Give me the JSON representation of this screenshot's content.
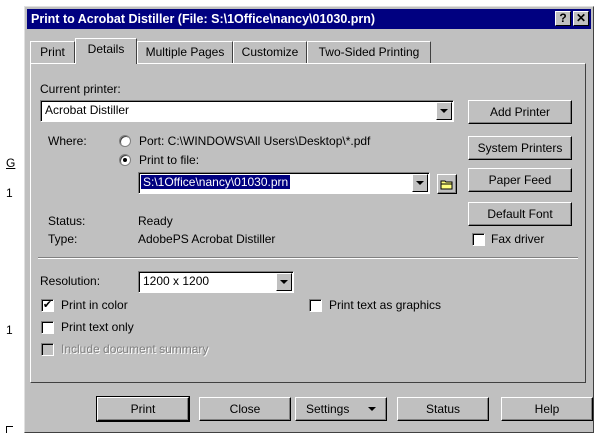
{
  "dialog": {
    "title": "Print to Acrobat Distiller   (File: S:\\1Office\\nancy\\01030.prn)",
    "help_glyph": "?",
    "close_glyph": "✕"
  },
  "tabs": [
    {
      "label": "Print"
    },
    {
      "label": "Details"
    },
    {
      "label": "Multiple Pages"
    },
    {
      "label": "Customize"
    },
    {
      "label": "Two-Sided Printing"
    }
  ],
  "details": {
    "current_printer_label": "Current printer:",
    "current_printer_value": "Acrobat Distiller",
    "where_label": "Where:",
    "port_label": "Port: C:\\WINDOWS\\All Users\\Desktop\\*.pdf",
    "print_to_file_label": "Print to file:",
    "file_path_value": "S:\\1Office\\nancy\\01030.prn",
    "status_label": "Status:",
    "status_value": "Ready",
    "type_label": "Type:",
    "type_value": "AdobePS Acrobat Distiller",
    "resolution_label": "Resolution:",
    "resolution_value": "1200 x 1200",
    "print_in_color": "Print in color",
    "print_text_only": "Print text only",
    "include_summary": "Include document summary",
    "print_text_graphics": "Print text as graphics",
    "fax_driver": "Fax driver"
  },
  "side_buttons": {
    "add_printer": "Add Printer",
    "system_printers": "System Printers",
    "paper_feed": "Paper Feed",
    "default_font": "Default Font"
  },
  "bottom_buttons": {
    "print": "Print",
    "close": "Close",
    "settings": "Settings",
    "status": "Status",
    "help": "Help"
  },
  "checks": {
    "checked_glyph": "✔"
  },
  "background": {
    "frag1": "G",
    "frag2": "1",
    "frag3": "1"
  }
}
